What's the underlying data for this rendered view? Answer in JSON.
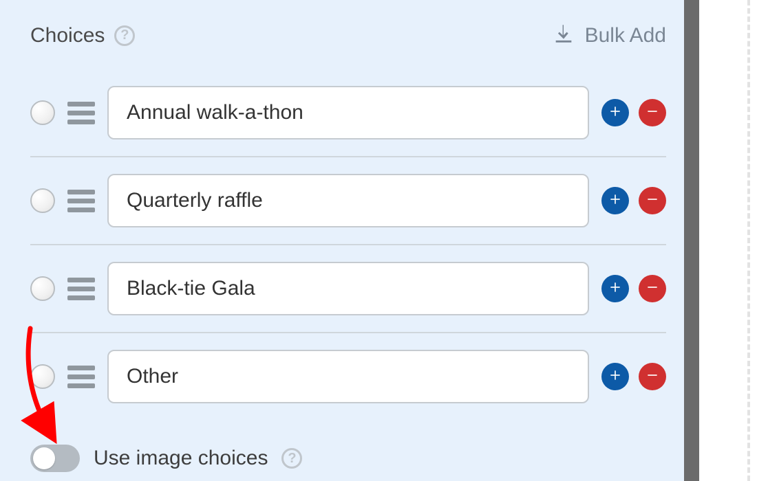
{
  "header": {
    "label": "Choices",
    "bulk_add_label": "Bulk Add"
  },
  "choices": [
    {
      "value": "Annual walk-a-thon"
    },
    {
      "value": "Quarterly raffle"
    },
    {
      "value": "Black-tie Gala"
    },
    {
      "value": "Other"
    }
  ],
  "image_choices": {
    "label": "Use image choices",
    "enabled": false
  }
}
